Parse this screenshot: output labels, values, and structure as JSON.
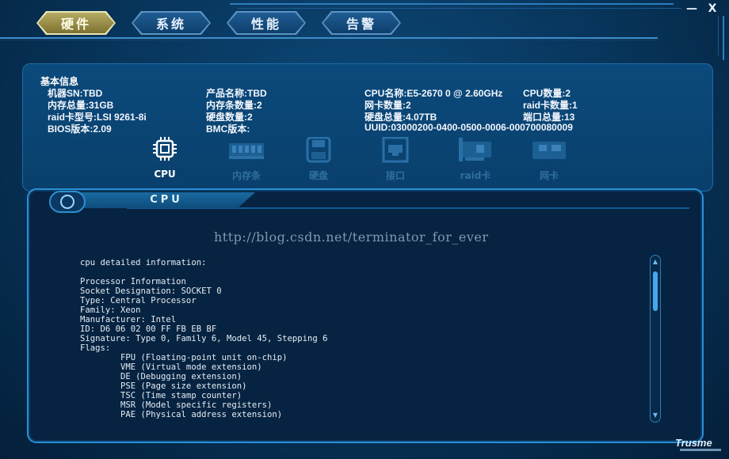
{
  "nav": {
    "tabs": [
      {
        "label": "硬件",
        "active": true
      },
      {
        "label": "系统",
        "active": false
      },
      {
        "label": "性能",
        "active": false
      },
      {
        "label": "告警",
        "active": false
      }
    ]
  },
  "window": {
    "minimize_label": "—",
    "close_label": "X"
  },
  "basic_info": {
    "title": "基本信息",
    "machine_sn": "机器SN:TBD",
    "product_name": "产品名称:TBD",
    "cpu_name": "CPU名称:E5-2670 0 @ 2.60GHz",
    "cpu_count": "CPU数量:2",
    "memory_total": "内存总量:31GB",
    "memory_count": "内存条数量:2",
    "nic_count": "网卡数量:2",
    "raid_count": "raid卡数量:1",
    "raid_model": "raid卡型号:LSI 9261-8i",
    "disk_count": "硬盘数量:2",
    "disk_total": "硬盘总量:4.07TB",
    "port_total": "端口总量:13",
    "bios_version": "BIOS版本:2.09",
    "bmc_version": "BMC版本:",
    "uuid": "UUID:03000200-0400-0500-0006-000700080009"
  },
  "components": [
    {
      "label": "CPU",
      "icon": "cpu-icon",
      "active": true
    },
    {
      "label": "内存条",
      "icon": "memory-icon",
      "active": false
    },
    {
      "label": "硬盘",
      "icon": "disk-icon",
      "active": false
    },
    {
      "label": "接口",
      "icon": "port-icon",
      "active": false
    },
    {
      "label": "raid卡",
      "icon": "raid-card-icon",
      "active": false
    },
    {
      "label": "网卡",
      "icon": "nic-icon",
      "active": false
    }
  ],
  "detail": {
    "title": "CPU",
    "watermark": "http://blog.csdn.net/terminator_for_ever",
    "lines": [
      "cpu detailed information:",
      "",
      "Processor Information",
      "Socket Designation: SOCKET 0",
      "Type: Central Processor",
      "Family: Xeon",
      "Manufacturer: Intel",
      "ID: D6 06 02 00 FF FB EB BF",
      "Signature: Type 0, Family 6, Model 45, Stepping 6",
      "Flags:",
      "        FPU (Floating-point unit on-chip)",
      "        VME (Virtual mode extension)",
      "        DE (Debugging extension)",
      "        PSE (Page size extension)",
      "        TSC (Time stamp counter)",
      "        MSR (Model specific registers)",
      "        PAE (Physical address extension)"
    ]
  },
  "brand": "Trusme",
  "colors": {
    "background": "#073358",
    "accent": "#2b8fd6",
    "active_tab": "#b5ab63",
    "inactive_component": "#2f6f9f"
  }
}
